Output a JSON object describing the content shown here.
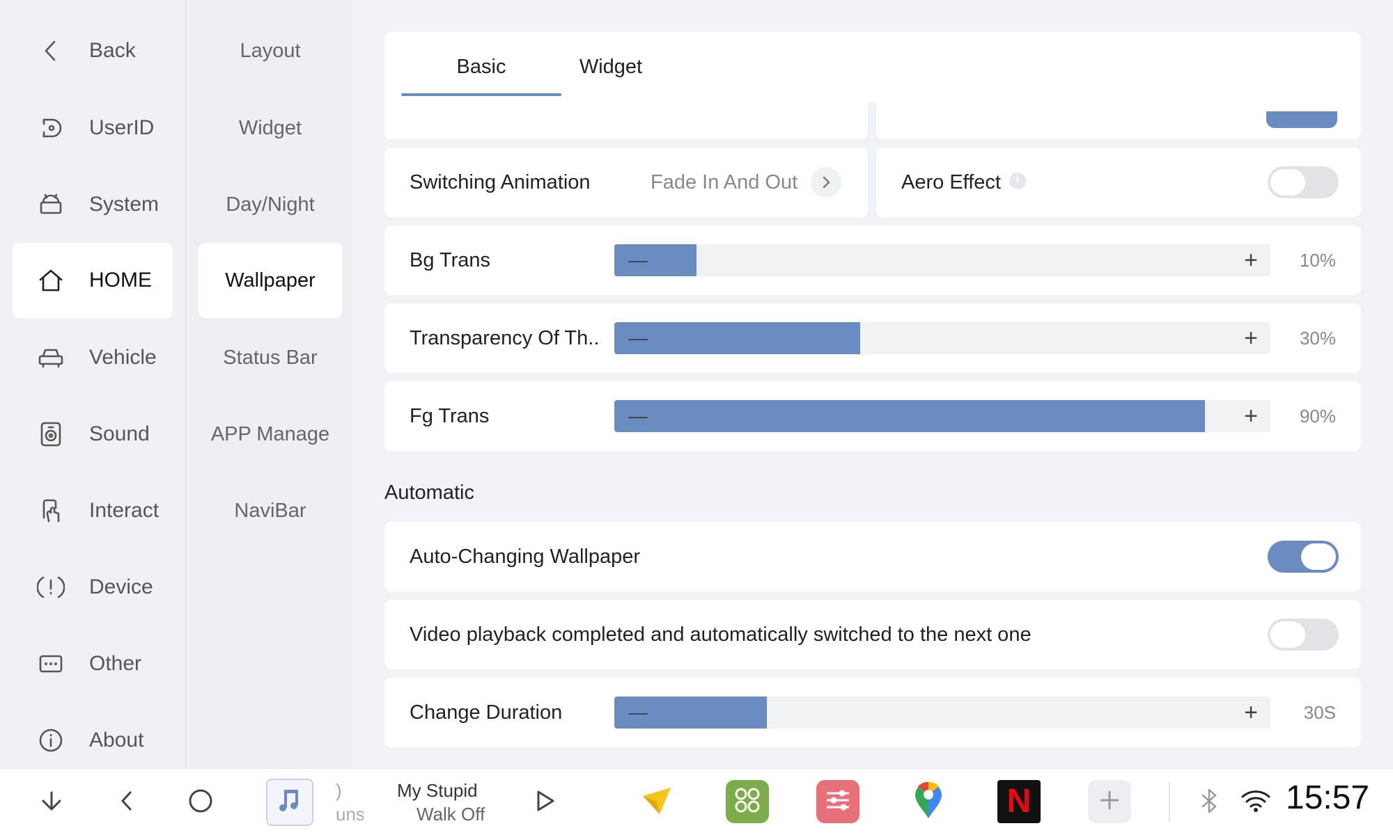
{
  "nav_primary": {
    "back_label": "Back",
    "items": [
      {
        "label": "UserID",
        "icon": "userid-icon"
      },
      {
        "label": "System",
        "icon": "android-icon"
      },
      {
        "label": "HOME",
        "icon": "home-icon",
        "active": true
      },
      {
        "label": "Vehicle",
        "icon": "car-icon"
      },
      {
        "label": "Sound",
        "icon": "speaker-icon"
      },
      {
        "label": "Interact",
        "icon": "touch-icon"
      },
      {
        "label": "Device",
        "icon": "alert-icon"
      },
      {
        "label": "Other",
        "icon": "more-icon"
      },
      {
        "label": "About",
        "icon": "info-icon"
      }
    ]
  },
  "nav_secondary": {
    "items": [
      {
        "label": "Layout"
      },
      {
        "label": "Widget"
      },
      {
        "label": "Day/Night"
      },
      {
        "label": "Wallpaper",
        "active": true
      },
      {
        "label": "Status Bar"
      },
      {
        "label": "APP Manage"
      },
      {
        "label": "NaviBar"
      }
    ]
  },
  "tabs": [
    {
      "label": "Basic",
      "active": true
    },
    {
      "label": "Widget",
      "active": false
    }
  ],
  "settings": {
    "switching_animation": {
      "label": "Switching Animation",
      "value": "Fade In And Out"
    },
    "aero_effect": {
      "label": "Aero Effect",
      "on": false
    },
    "bg_trans": {
      "label": "Bg Trans",
      "value": "10%",
      "fraction": 0.125
    },
    "transparency": {
      "label": "Transparency Of Th..",
      "value": "30%",
      "fraction": 0.375
    },
    "fg_trans": {
      "label": "Fg Trans",
      "value": "90%",
      "fraction": 0.9
    }
  },
  "automatic": {
    "title": "Automatic",
    "auto_wallpaper": {
      "label": "Auto-Changing Wallpaper",
      "on": true
    },
    "video_next": {
      "label": "Video playback completed and automatically switched to the next one",
      "on": false
    },
    "change_duration": {
      "label": "Change Duration",
      "value": "30S",
      "fraction": 0.232
    }
  },
  "bottom_bar": {
    "media": {
      "line1": "My Stupid",
      "line2": "Walk Off",
      "prev_line1": ")",
      "prev_line2": "uns"
    },
    "apps": [
      "navigation-icon",
      "apps-grid-icon",
      "equalizer-icon",
      "maps-pin-icon",
      "netflix-icon",
      "add-icon"
    ],
    "netflix_letter": "N",
    "time": "15:57"
  },
  "colors": {
    "accent": "#6a8cc0",
    "background": "#f2f3f7",
    "card": "#ffffff",
    "apps_green": "#7cad4a",
    "equalizer_red": "#e8707a",
    "netflix_red": "#e50914"
  }
}
